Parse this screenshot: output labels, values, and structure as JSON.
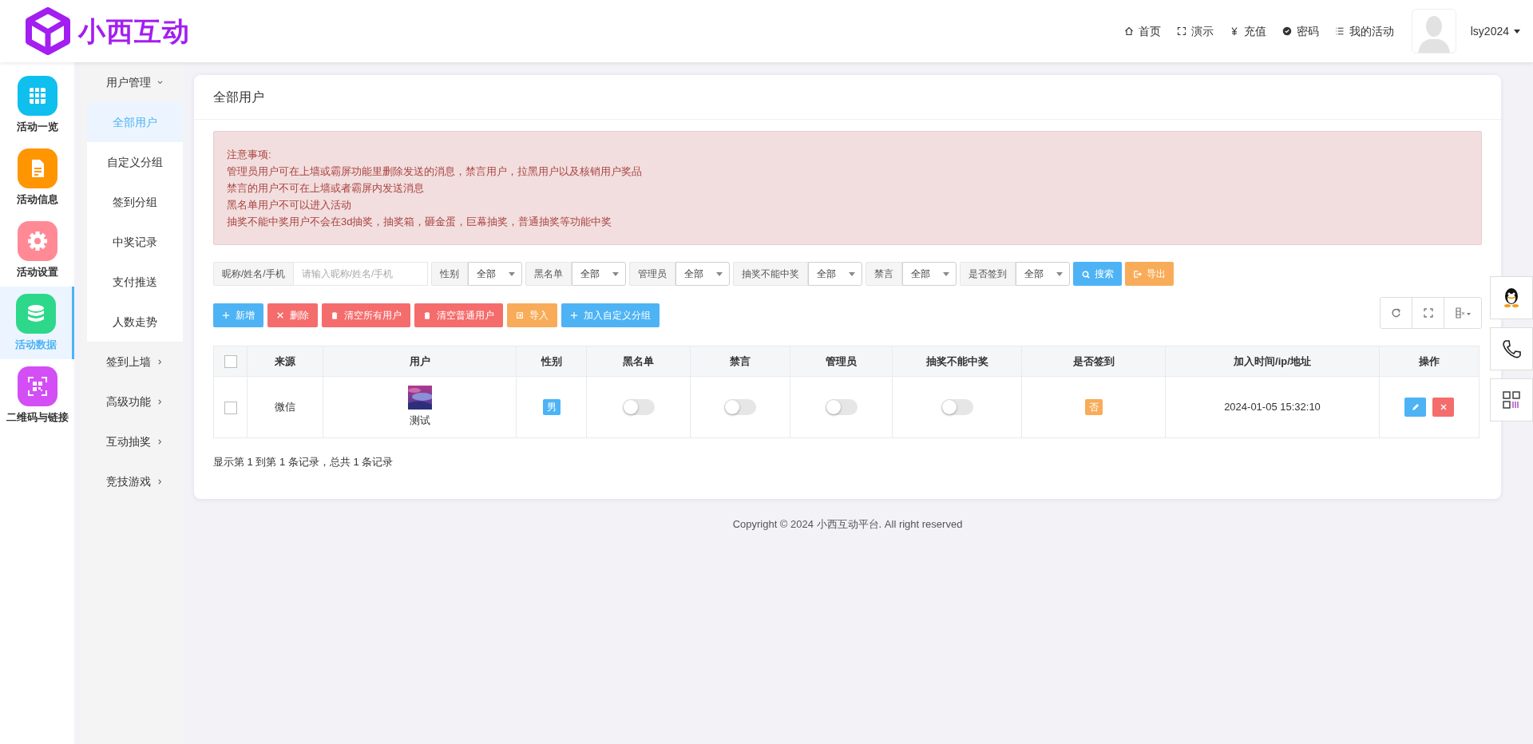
{
  "logo": {
    "text": "小西互动"
  },
  "top_nav": [
    {
      "label": "首页"
    },
    {
      "label": "演示"
    },
    {
      "label": "充值"
    },
    {
      "label": "密码"
    },
    {
      "label": "我的活动"
    }
  ],
  "user": {
    "name": "lsy2024"
  },
  "rail": [
    {
      "label": "活动一览",
      "color": "#0fbfee",
      "selected": false
    },
    {
      "label": "活动信息",
      "color": "#ff9500",
      "selected": false
    },
    {
      "label": "活动设置",
      "color": "#ff8a96",
      "selected": false
    },
    {
      "label": "活动数据",
      "color": "#2ed88a",
      "selected": true
    },
    {
      "label": "二维码与链接",
      "color": "#d34ef5",
      "selected": false
    }
  ],
  "submenu": [
    {
      "label": "用户管理",
      "expanded": true,
      "children": [
        {
          "label": "全部用户",
          "selected": true
        },
        {
          "label": "自定义分组",
          "selected": false
        },
        {
          "label": "签到分组",
          "selected": false
        },
        {
          "label": "中奖记录",
          "selected": false
        },
        {
          "label": "支付推送",
          "selected": false
        },
        {
          "label": "人数走势",
          "selected": false
        }
      ]
    },
    {
      "label": "签到上墙",
      "expanded": false
    },
    {
      "label": "高级功能",
      "expanded": false
    },
    {
      "label": "互动抽奖",
      "expanded": false
    },
    {
      "label": "竞技游戏",
      "expanded": false
    }
  ],
  "card_title": "全部用户",
  "notice": [
    "注意事项:",
    "管理员用户可在上墙或霸屏功能里删除发送的消息，禁言用户，拉黑用户以及核销用户奖品",
    "禁言的用户不可在上墙或者霸屏内发送消息",
    "黑名单用户不可以进入活动",
    "抽奖不能中奖用户不会在3d抽奖，抽奖箱，砸金蛋，巨幕抽奖，普通抽奖等功能中奖"
  ],
  "filters": [
    {
      "kind": "input",
      "label": "昵称/姓名/手机",
      "placeholder": "请输入昵称/姓名/手机"
    },
    {
      "kind": "select",
      "label": "性别",
      "value": "全部"
    },
    {
      "kind": "select",
      "label": "黑名单",
      "value": "全部"
    },
    {
      "kind": "select",
      "label": "管理员",
      "value": "全部"
    },
    {
      "kind": "select",
      "label": "抽奖不能中奖",
      "value": "全部"
    },
    {
      "kind": "select",
      "label": "禁言",
      "value": "全部"
    },
    {
      "kind": "select",
      "label": "是否签到",
      "value": "全部"
    }
  ],
  "filter_buttons": [
    {
      "label": "搜索",
      "color": "#4db3f5"
    },
    {
      "label": "导出",
      "color": "#f8ac59"
    }
  ],
  "actions": [
    {
      "label": "新增",
      "color": "#4db3f5"
    },
    {
      "label": "删除",
      "color": "#f56c6c"
    },
    {
      "label": "清空所有用户",
      "color": "#f56c6c"
    },
    {
      "label": "清空普通用户",
      "color": "#f56c6c"
    },
    {
      "label": "导入",
      "color": "#f8ac59"
    },
    {
      "label": "加入自定义分组",
      "color": "#4db3f5"
    }
  ],
  "table": {
    "all_checked": false,
    "columns": [
      "来源",
      "用户",
      "性别",
      "黑名单",
      "禁言",
      "管理员",
      "抽奖不能中奖",
      "是否签到",
      "加入时间/ip/地址",
      "操作"
    ],
    "rows": [
      {
        "checked": false,
        "source": "微信",
        "user": "测试",
        "gender": "男",
        "blacklist": false,
        "muted": false,
        "admin": false,
        "no_prize": false,
        "signed": "否",
        "joined": "2024-01-05 15:32:10"
      }
    ]
  },
  "pagination": "显示第 1 到第 1 条记录，总共 1 条记录",
  "footer": "Copyright © 2024 小西互动平台. All right reserved"
}
